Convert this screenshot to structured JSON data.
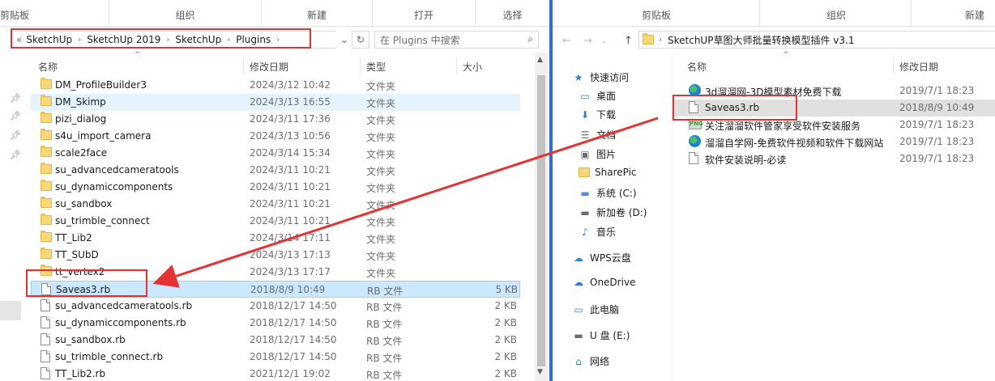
{
  "left_window": {
    "ribbon_groups": [
      "剪贴板",
      "组织",
      "新建",
      "打开",
      "选择"
    ],
    "breadcrumb": [
      "SketchUp",
      "SketchUp 2019",
      "SketchUp",
      "Plugins"
    ],
    "breadcrumb_prefix": "«",
    "search_placeholder": "在 Plugins 中搜索",
    "columns": [
      "名称",
      "修改日期",
      "类型",
      "大小"
    ],
    "files": [
      {
        "name": "DM_ProfileBuilder3",
        "date": "2024/3/12 10:42",
        "type": "文件夹",
        "size": "",
        "kind": "folder"
      },
      {
        "name": "DM_Skimp",
        "date": "2024/3/13 16:55",
        "type": "文件夹",
        "size": "",
        "kind": "folder"
      },
      {
        "name": "pizi_dialog",
        "date": "2024/3/11 17:36",
        "type": "文件夹",
        "size": "",
        "kind": "folder"
      },
      {
        "name": "s4u_import_camera",
        "date": "2024/3/13 10:56",
        "type": "文件夹",
        "size": "",
        "kind": "folder"
      },
      {
        "name": "scale2face",
        "date": "2024/3/14 15:34",
        "type": "文件夹",
        "size": "",
        "kind": "folder"
      },
      {
        "name": "su_advancedcameratools",
        "date": "2024/3/11 10:21",
        "type": "文件夹",
        "size": "",
        "kind": "folder"
      },
      {
        "name": "su_dynamiccomponents",
        "date": "2024/3/11 10:21",
        "type": "文件夹",
        "size": "",
        "kind": "folder"
      },
      {
        "name": "su_sandbox",
        "date": "2024/3/11 10:21",
        "type": "文件夹",
        "size": "",
        "kind": "folder"
      },
      {
        "name": "su_trimble_connect",
        "date": "2024/3/11 10:21",
        "type": "文件夹",
        "size": "",
        "kind": "folder"
      },
      {
        "name": "TT_Lib2",
        "date": "2024/3/14 17:11",
        "type": "文件夹",
        "size": "",
        "kind": "folder"
      },
      {
        "name": "TT_SUbD",
        "date": "2024/3/13 17:13",
        "type": "文件夹",
        "size": "",
        "kind": "folder"
      },
      {
        "name": "tt_vertex2",
        "date": "2024/3/13 17:17",
        "type": "文件夹",
        "size": "",
        "kind": "folder"
      },
      {
        "name": "Saveas3.rb",
        "date": "2018/8/9 10:49",
        "type": "RB 文件",
        "size": "5 KB",
        "kind": "file"
      },
      {
        "name": "su_advancedcameratools.rb",
        "date": "2018/12/17 14:50",
        "type": "RB 文件",
        "size": "2 KB",
        "kind": "file"
      },
      {
        "name": "su_dynamiccomponents.rb",
        "date": "2018/12/17 14:50",
        "type": "RB 文件",
        "size": "2 KB",
        "kind": "file"
      },
      {
        "name": "su_sandbox.rb",
        "date": "2018/12/17 14:50",
        "type": "RB 文件",
        "size": "2 KB",
        "kind": "file"
      },
      {
        "name": "su_trimble_connect.rb",
        "date": "2018/12/17 14:50",
        "type": "RB 文件",
        "size": "2 KB",
        "kind": "file"
      },
      {
        "name": "TT_Lib2.rb",
        "date": "2021/12/1 19:02",
        "type": "RB 文件",
        "size": "2 KB",
        "kind": "file"
      }
    ]
  },
  "right_window": {
    "ribbon_groups": [
      "剪贴板",
      "组织",
      "新建"
    ],
    "breadcrumb": [
      "SketchUP草图大师批量转换模型插件 v3.1"
    ],
    "columns": [
      "名称",
      "修改日期"
    ],
    "nav": [
      {
        "label": "快速访问",
        "icon": "star-icon",
        "color": "#2b7cd3"
      },
      {
        "label": "桌面",
        "icon": "desktop-icon",
        "color": "#2b8ad8"
      },
      {
        "label": "下载",
        "icon": "download-icon",
        "color": "#2b7cd3"
      },
      {
        "label": "文档",
        "icon": "document-icon",
        "color": "#6d6d6d"
      },
      {
        "label": "图片",
        "icon": "picture-icon",
        "color": "#6d6d6d"
      },
      {
        "label": "SharePic",
        "icon": "folder-icon",
        "color": "#f8d775"
      },
      {
        "label": "系统 (C:)",
        "icon": "drive-icon",
        "color": "#4a8ad6"
      },
      {
        "label": "新加卷 (D:)",
        "icon": "drive-icon",
        "color": "#6d6d6d"
      },
      {
        "label": "音乐",
        "icon": "music-icon",
        "color": "#2b7cd3"
      },
      {
        "label": "WPS云盘",
        "icon": "cloud-icon",
        "color": "#2b8ad8"
      },
      {
        "label": "OneDrive",
        "icon": "onedrive-icon",
        "color": "#2b7cd3"
      },
      {
        "label": "此电脑",
        "icon": "computer-icon",
        "color": "#2b8ad8"
      },
      {
        "label": "U 盘 (E:)",
        "icon": "usb-drive-icon",
        "color": "#6d6d6d"
      },
      {
        "label": "网络",
        "icon": "network-icon",
        "color": "#2b7cd3"
      }
    ],
    "files": [
      {
        "name": "3d溜溜网-3D模型素材免费下载",
        "date": "2019/7/1 18:23",
        "kind": "globe"
      },
      {
        "name": "Saveas3.rb",
        "date": "2018/8/9 10:49",
        "kind": "file"
      },
      {
        "name": "关注溜溜软件管家享受软件安装服务",
        "date": "2019/7/1 18:23",
        "kind": "png"
      },
      {
        "name": "溜溜自学网-免费软件视频和软件下载网站",
        "date": "2019/7/1 18:23",
        "kind": "globe"
      },
      {
        "name": "软件安装说明-必读",
        "date": "2019/7/1 18:23",
        "kind": "file"
      }
    ]
  },
  "colors": {
    "annotation": "#e63232",
    "selection": "#cce8ff",
    "hover": "#e5f3ff",
    "folder": "#f8d775"
  }
}
